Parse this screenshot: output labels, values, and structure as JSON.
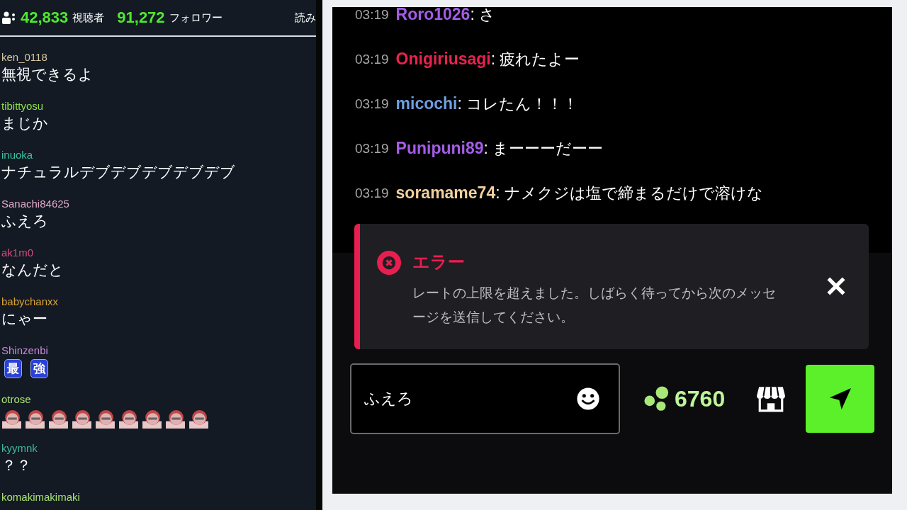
{
  "stream_stats": {
    "viewers": "42,833",
    "viewers_label": "視聴者",
    "followers": "91,272",
    "followers_label": "フォロワー",
    "cut_label": "読み"
  },
  "side_chat": [
    {
      "user": "ken_0118",
      "color": "#d8c8a0",
      "text": "無視できるよ"
    },
    {
      "user": "tibittyosu",
      "color": "#8fe04a",
      "text": "まじか"
    },
    {
      "user": "inuoka",
      "color": "#3dbf9f",
      "text": "ナチュラルデブデブデブデブデブ"
    },
    {
      "user": "Sanachi84625",
      "color": "#e0a8c8",
      "text": "ふえろ"
    },
    {
      "user": "ak1m0",
      "color": "#d0507a",
      "text": "なんだと"
    },
    {
      "user": "babychanxx",
      "color": "#d9a030",
      "text": "にゃー"
    },
    {
      "user": "Shinzenbi",
      "color": "#c68ad6",
      "emotes": [
        {
          "kind": "glyph",
          "text": "最"
        },
        {
          "kind": "glyph",
          "text": "強"
        }
      ]
    },
    {
      "user": "otrose",
      "color": "#a8e070",
      "emotes": [
        {
          "kind": "picture"
        },
        {
          "kind": "picture"
        },
        {
          "kind": "picture"
        },
        {
          "kind": "picture"
        },
        {
          "kind": "picture"
        },
        {
          "kind": "picture"
        },
        {
          "kind": "picture"
        },
        {
          "kind": "picture"
        },
        {
          "kind": "picture"
        }
      ]
    },
    {
      "user": "kyymnk",
      "color": "#40b89a",
      "text": "？？"
    },
    {
      "user": "komakimakimaki",
      "color": "#a8e070"
    }
  ],
  "chat": [
    {
      "time": "03:19",
      "user": "Roro1026",
      "color": "#a55ce8",
      "separator": ":",
      "text": "さ"
    },
    {
      "time": "03:19",
      "user": "Onigiriusagi",
      "color": "#e8234f",
      "separator": ":",
      "text": "疲れたよー"
    },
    {
      "time": "03:19",
      "user": "micochi",
      "color": "#6f9fe0",
      "separator": ":",
      "text": "コレたん！！！"
    },
    {
      "time": "03:19",
      "user": "Punipuni89",
      "color": "#a55ce8",
      "separator": ":",
      "text": "まーーーだーー"
    },
    {
      "time": "03:19",
      "user": "soramame74",
      "color": "#f0d0a0",
      "separator": ":",
      "text": "ナメクジは塩で締まるだけで溶けな"
    }
  ],
  "error_toast": {
    "title": "エラー",
    "message": "レートの上限を超えました。しばらく待ってから次のメッセージを送信してください。"
  },
  "input": {
    "value": "ふえろ"
  },
  "points": "6760"
}
